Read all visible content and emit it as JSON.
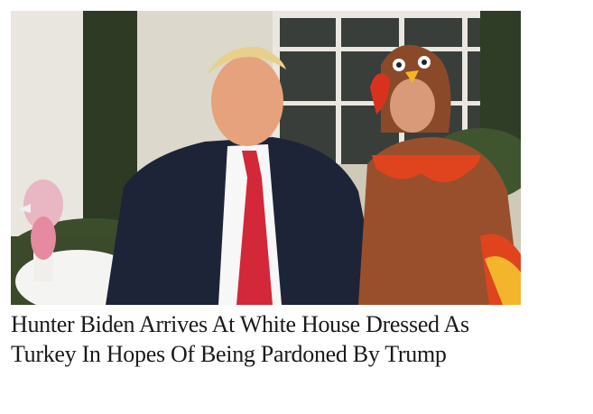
{
  "article": {
    "headline": "Hunter Biden Arrives At White House Dressed As Turkey In Hopes Of Being Pardoned By Trump",
    "image_alt": "",
    "colors": {
      "headline_text": "#1a1a1a",
      "background": "#ffffff"
    }
  }
}
